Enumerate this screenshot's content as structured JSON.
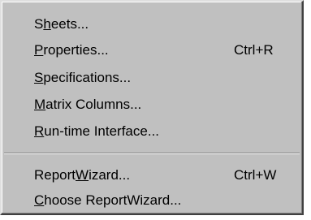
{
  "menu": {
    "items": [
      {
        "pre": "S",
        "mn": "h",
        "post": "eets...",
        "accel": ""
      },
      {
        "pre": "",
        "mn": "P",
        "post": "roperties...",
        "accel": "Ctrl+R"
      },
      {
        "pre": "",
        "mn": "S",
        "post": "pecifications...",
        "accel": ""
      },
      {
        "pre": "",
        "mn": "M",
        "post": "atrix Columns...",
        "accel": ""
      },
      {
        "pre": "",
        "mn": "R",
        "post": "un-time Interface...",
        "accel": ""
      },
      {
        "pre": "Report",
        "mn": "W",
        "post": "izard...",
        "accel": "Ctrl+W"
      },
      {
        "pre": "",
        "mn": "C",
        "post": "hoose ReportWizard...",
        "accel": ""
      }
    ]
  },
  "colors": {
    "menu_face": "#c0c0c0",
    "highlight": "#ffffff",
    "shadow": "#808080",
    "dark_shadow": "#404040",
    "text": "#000000"
  }
}
